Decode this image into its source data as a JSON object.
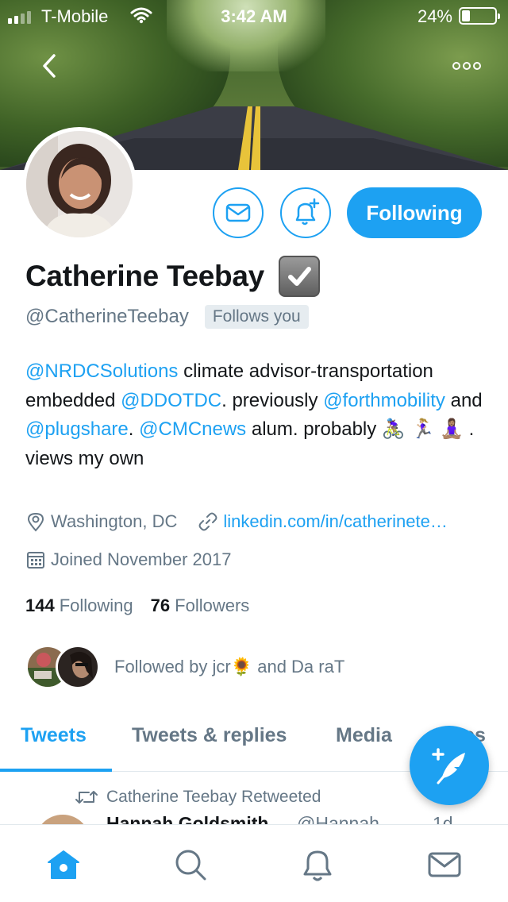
{
  "status_bar": {
    "carrier": "T-Mobile",
    "time": "3:42 AM",
    "battery": "24%",
    "battery_level": 0.24,
    "icons": [
      "signal-icon",
      "wifi-icon",
      "battery-icon"
    ]
  },
  "header": {
    "back_icon": "chevron-left-icon",
    "more_icon": "more-options-icon"
  },
  "profile": {
    "name": "Catherine Teebay",
    "handle": "@CatherineTeebay",
    "follows_you": "Follows you",
    "following_button": "Following",
    "message_icon": "mail-icon",
    "notify_icon": "bell-plus-icon",
    "verified_icon": "checkmark-box-icon",
    "bio": {
      "m1": "@NRDCSolutions",
      "t1": " climate advisor-transportation embedded ",
      "m2": "@DDOTDC",
      "t2": ". previously ",
      "m3": "@forthmobility",
      "t3": " and ",
      "m4": "@plugshare",
      "t4": ". ",
      "m5": "@CMCnews",
      "t5": " alum. probably 🚴🏽‍♀️ 🏃🏼‍♀️ 🧘🏽‍♀️ . views my own"
    },
    "location": "Washington, DC",
    "website": "linkedin.com/in/catherinete…",
    "joined": "Joined November 2017",
    "following_count": "144",
    "following_label": "Following",
    "followers_count": "76",
    "followers_label": "Followers",
    "followed_by": "Followed by jcr🌻 and Da raT"
  },
  "tabs": [
    "Tweets",
    "Tweets & replies",
    "Media",
    "Likes"
  ],
  "active_tab": "Tweets",
  "timeline": {
    "retweet_label": "Catherine Teebay Retweeted",
    "first_tweet": {
      "name": "Hannah Goldsmith",
      "handle": "@Hannah",
      "time": "1d"
    }
  },
  "bottom_nav": [
    "home-icon",
    "search-icon",
    "notifications-icon",
    "messages-icon"
  ],
  "colors": {
    "accent": "#1da1f2",
    "text": "#14171a",
    "secondary": "#657786",
    "divider": "#e1e8ed"
  }
}
